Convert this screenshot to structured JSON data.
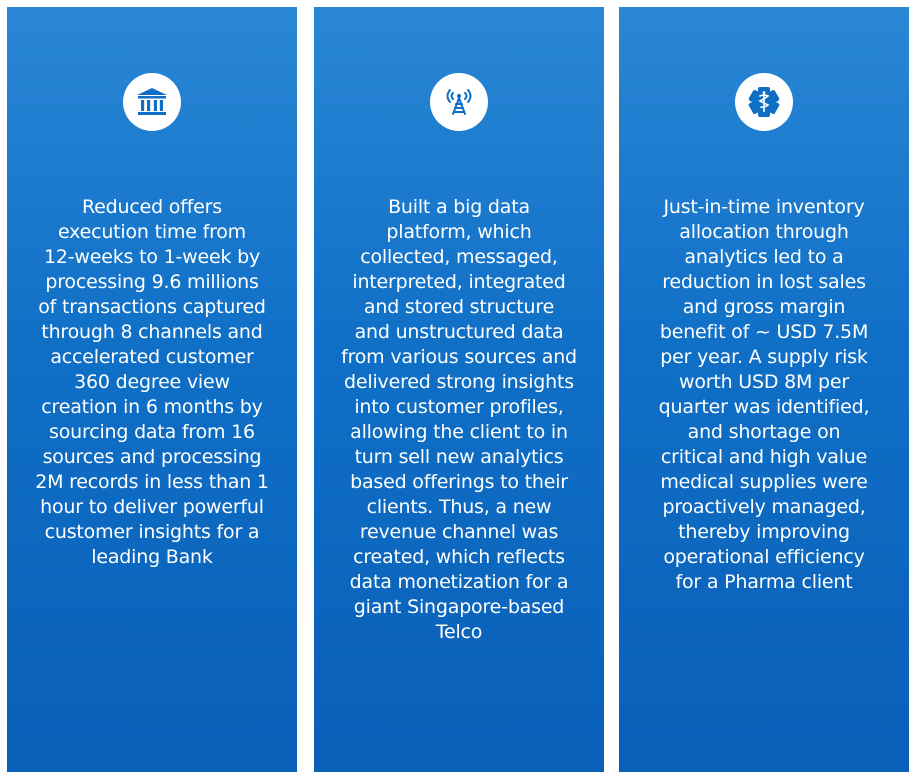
{
  "colors": {
    "card_top": "#2a87d6",
    "card_bottom": "#0a5fb8",
    "icon_bg": "#ffffff",
    "icon_fg": "#0f6fc6",
    "text": "#ffffff"
  },
  "cards": [
    {
      "icon": "bank-icon",
      "lines": [
        "Reduced offers",
        "execution time from",
        "12-weeks to 1-week by",
        "processing 9.6 millions",
        "of transactions captured",
        "through 8 channels and",
        "accelerated customer",
        "360 degree view",
        "creation in 6 months by",
        "sourcing data from 16",
        "sources and processing",
        "2M records in less than 1",
        "hour to deliver powerful",
        "customer insights for a",
        "leading Bank"
      ]
    },
    {
      "icon": "signal-tower-icon",
      "lines": [
        "Built a big data",
        "platform, which",
        "collected, messaged,",
        "interpreted, integrated",
        "and stored structure",
        "and unstructured data",
        "from various sources and",
        "delivered strong insights",
        "into customer profiles,",
        "allowing the client to in",
        "turn sell new analytics",
        "based offerings to their",
        "clients. Thus, a new",
        "revenue channel was",
        "created, which reflects",
        "data monetization for a",
        "giant Singapore-based",
        "Telco"
      ]
    },
    {
      "icon": "medical-caduceus-icon",
      "lines": [
        "Just-in-time inventory",
        "allocation through",
        "analytics led to a",
        "reduction in lost sales",
        "and gross margin",
        "benefit of ~ USD 7.5M",
        "per year. A supply risk",
        "worth USD 8M per",
        "quarter was identified,",
        "and shortage on",
        "critical and high value",
        "medical supplies were",
        "proactively managed,",
        "thereby improving",
        "operational efficiency",
        "for a Pharma client"
      ]
    }
  ]
}
